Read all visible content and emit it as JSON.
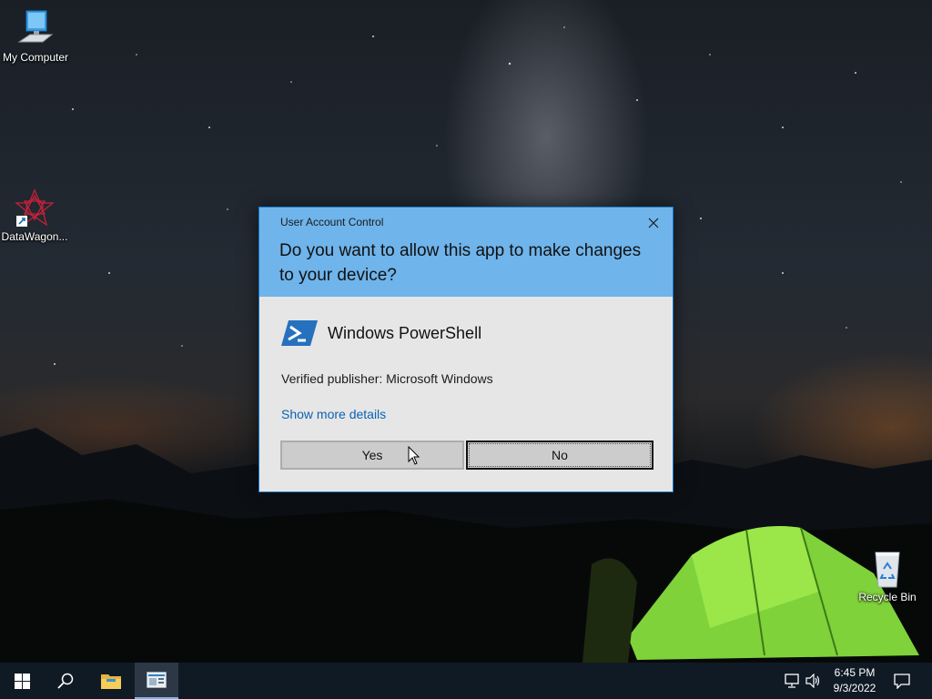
{
  "desktop": {
    "icons": [
      {
        "label": "My Computer"
      },
      {
        "label": "DataWagon..."
      },
      {
        "label": "Recycle Bin"
      }
    ]
  },
  "uac": {
    "window_title": "User Account Control",
    "question": "Do you want to allow this app to make changes to your device?",
    "app_name": "Windows PowerShell",
    "publisher": "Verified publisher: Microsoft Windows",
    "details_link": "Show more details",
    "yes_label": "Yes",
    "no_label": "No",
    "header_color": "#6fb4eb"
  },
  "taskbar": {
    "pinned": [
      "start-icon",
      "search-icon",
      "file-explorer-icon",
      "server-manager-icon"
    ],
    "tray_icons": [
      "network-icon",
      "volume-icon"
    ],
    "time": "6:45 PM",
    "date": "9/3/2022",
    "notification": "notification-icon"
  }
}
